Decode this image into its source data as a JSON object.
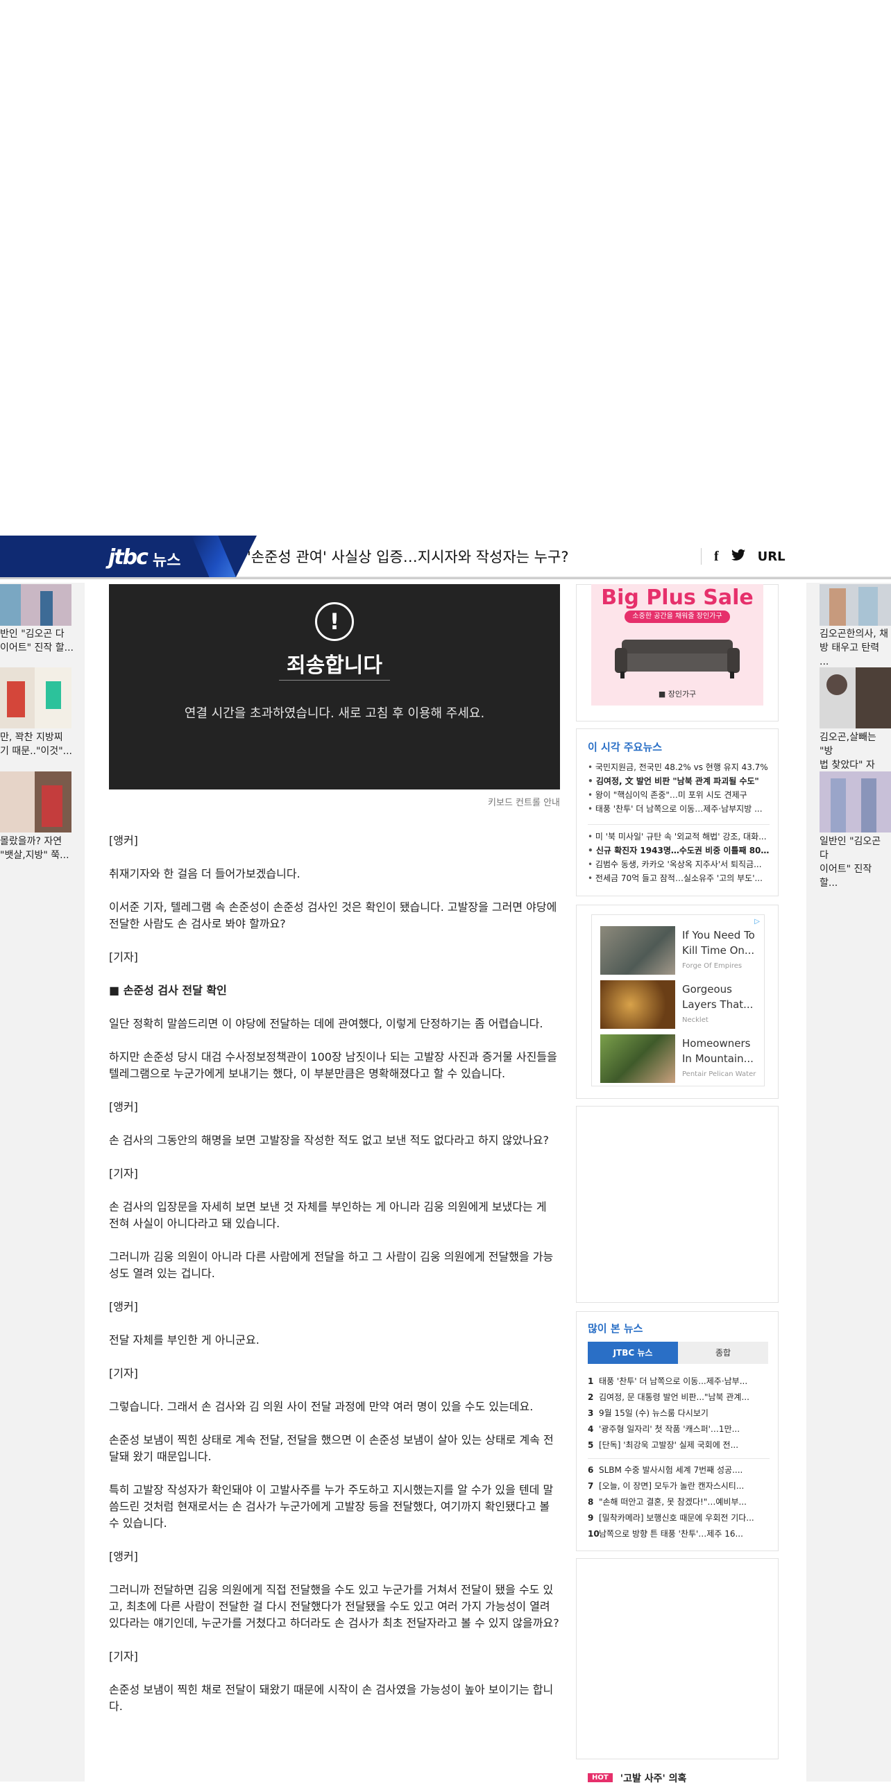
{
  "header": {
    "brand_logo": "jtbc",
    "brand_news": "뉴스",
    "headline": "'손준성 관여' 사실상 입증…지시자와 작성자는 누구?",
    "share_facebook": "f",
    "share_url": "URL"
  },
  "left_thumbs": [
    {
      "caption": "반인 \"김오곤 다\n이어트\" 진작 할..."
    },
    {
      "caption": "만, 꽉찬 지방찌\n기 때문..\"이것\"..."
    },
    {
      "caption": "몰랐을까? 자연\n\"뱃살,지방\" 쭉..."
    }
  ],
  "right_thumbs": [
    {
      "caption": "김오곤한의사, 채\n방 태우고 탄력 ..."
    },
    {
      "caption": "김오곤,살빼는 \"방\n법 찾았다\" 자연..."
    },
    {
      "caption": "일반인 \"김오곤 다\n이어트\" 진작 할..."
    }
  ],
  "video": {
    "alert_symbol": "!",
    "title": "죄송합니다",
    "message": "연결 시간을 초과하였습니다. 새로 고침 후 이용해 주세요.",
    "keyboard_link": "키보드 컨트롤 안내"
  },
  "article": {
    "paragraphs": [
      {
        "text": "[앵커]",
        "bold": false
      },
      {
        "text": "취재기자와 한 걸음 더 들어가보겠습니다.",
        "bold": false
      },
      {
        "text": "이서준 기자, 텔레그램 속 손준성이 손준성 검사인 것은 확인이 됐습니다. 고발장을 그러면 야당에 전달한 사람도 손 검사로 봐야 할까요?",
        "bold": false
      },
      {
        "text": "[기자]",
        "bold": false
      },
      {
        "text": "■ 손준성 검사 전달 확인",
        "bold": true
      },
      {
        "text": "일단 정확히 말씀드리면 이 야당에 전달하는 데에 관여했다, 이렇게 단정하기는 좀 어렵습니다.",
        "bold": false
      },
      {
        "text": "하지만 손준성 당시 대검 수사정보정책관이 100장 남짓이나 되는 고발장 사진과 증거물 사진들을 텔레그램으로 누군가에게 보내기는 했다, 이 부분만큼은 명확해졌다고 할 수 있습니다.",
        "bold": false
      },
      {
        "text": "[앵커]",
        "bold": false
      },
      {
        "text": "손 검사의 그동안의 해명을 보면 고발장을 작성한 적도 없고 보낸 적도 없다라고 하지 않았나요?",
        "bold": false
      },
      {
        "text": "[기자]",
        "bold": false
      },
      {
        "text": "손 검사의 입장문을 자세히 보면 보낸 것 자체를 부인하는 게 아니라 김웅 의원에게 보냈다는 게 전혀 사실이 아니다라고 돼 있습니다.",
        "bold": false
      },
      {
        "text": "그러니까 김웅 의원이 아니라 다른 사람에게 전달을 하고 그 사람이 김웅 의원에게 전달했을 가능성도 열려 있는 겁니다.",
        "bold": false
      },
      {
        "text": "[앵커]",
        "bold": false
      },
      {
        "text": "전달 자체를 부인한 게 아니군요.",
        "bold": false
      },
      {
        "text": "[기자]",
        "bold": false
      },
      {
        "text": "그렇습니다. 그래서 손 검사와 김 의원 사이 전달 과정에 만약 여러 명이 있을 수도 있는데요.",
        "bold": false
      },
      {
        "text": "손준성 보냄이 찍힌 상태로 계속 전달, 전달을 했으면 이 손준성 보냄이 살아 있는 상태로 계속 전달돼 왔기 때문입니다.",
        "bold": false
      },
      {
        "text": "특히 고발장 작성자가 확인돼야 이 고발사주를 누가 주도하고 지시했는지를 알 수가 있을 텐데 말씀드린 것처럼 현재로서는 손 검사가 누군가에게 고발장 등을 전달했다, 여기까지 확인됐다고 볼 수 있습니다.",
        "bold": false
      },
      {
        "text": "[앵커]",
        "bold": false
      },
      {
        "text": "그러니까 전달하면 김웅 의원에게 직접 전달했을 수도 있고 누군가를 거쳐서 전달이 됐을 수도 있고, 최초에 다른 사람이 전달한 걸 다시 전달했다가 전달됐을 수도 있고 여러 가지 가능성이 열려 있다라는 얘기인데, 누군가를 거쳤다고 하더라도 손 검사가 최초 전달자라고 볼 수 있지 않을까요?",
        "bold": false
      },
      {
        "text": "[기자]",
        "bold": false
      },
      {
        "text": "손준성 보냄이 찍힌 채로 전달이 돼왔기 때문에 시작이 손 검사였을 가능성이 높아 보이기는 합니다.",
        "bold": false
      }
    ]
  },
  "ad_top": {
    "title": "Big Plus Sale",
    "pill": "소중한 공간을 채워줄 장인가구",
    "brand": "■ 장인가구"
  },
  "major_news": {
    "title": "이 시각 주요뉴스",
    "group1": [
      {
        "text": "국민지원금, 전국민 48.2% vs 현행 유지 43.7%",
        "bold": false
      },
      {
        "text": "김여정, 文 발언 비판 \"남북 관계 파괴될 수도\"",
        "bold": true
      },
      {
        "text": "왕이 \"핵심이익 존중\"…미 포위 시도 견제구",
        "bold": false
      },
      {
        "text": "태풍 '찬투' 더 남쪽으로 이동…제주·남부지방 ...",
        "bold": false
      }
    ],
    "group2": [
      {
        "text": "미 '북 미사일' 규탄 속 '외교적 해법' 강조, 대화...",
        "bold": false
      },
      {
        "text": "신규 확진자 1943명…수도권 비중 이틀째 80...",
        "bold": true
      },
      {
        "text": "김범수 동생, 카카오 '옥상옥 지주사'서 퇴직금...",
        "bold": false
      },
      {
        "text": "전세금 70억 들고 잠적…실소유주 '고의 부도'...",
        "bold": false
      }
    ]
  },
  "native_ads": {
    "adchoice": "▷",
    "items": [
      {
        "title": "If You Need To Kill Time On...",
        "source": "Forge Of Empires"
      },
      {
        "title": "Gorgeous Layers That...",
        "source": "Necklet"
      },
      {
        "title": "Homeowners In Mountain...",
        "source": "Pentair Pelican Water"
      }
    ]
  },
  "most_viewed": {
    "title": "많이 본 뉴스",
    "tab_jtbc": "JTBC 뉴스",
    "tab_all": "종합",
    "items": [
      {
        "rank": "1",
        "text": "태풍 '찬투' 더 남쪽으로 이동...제주·남부..."
      },
      {
        "rank": "2",
        "text": "김여정, 문 대통령 발언 비판...\"남북 관계..."
      },
      {
        "rank": "3",
        "text": "9월 15일 (수) 뉴스룸 다시보기"
      },
      {
        "rank": "4",
        "text": "'광주형 일자리' 첫 작품 '캐스퍼'…1만..."
      },
      {
        "rank": "5",
        "text": "[단독] '최강욱 고발장' 실제 국회에 전..."
      },
      {
        "rank": "6",
        "text": "SLBM 수중 발사시험 세계 7번째 성공...."
      },
      {
        "rank": "7",
        "text": "[오늘, 이 장면] 모두가 놀란 캔자스시티..."
      },
      {
        "rank": "8",
        "text": "\"손해 떠안고 결혼, 못 참겠다!\"…예비부..."
      },
      {
        "rank": "9",
        "text": "[밀착카메라] 보행신호 때문에 우회전 기다..."
      },
      {
        "rank": "10",
        "text": "남쪽으로 방향 튼 태풍 '찬투'…제주 16..."
      }
    ]
  },
  "hot": {
    "tag": "HOT",
    "title": "'고발 사주' 의혹"
  },
  "colors": {
    "brand_navy": "#0f2a72",
    "accent_blue": "#2a6fc6",
    "hot_pink": "#e6306b"
  }
}
